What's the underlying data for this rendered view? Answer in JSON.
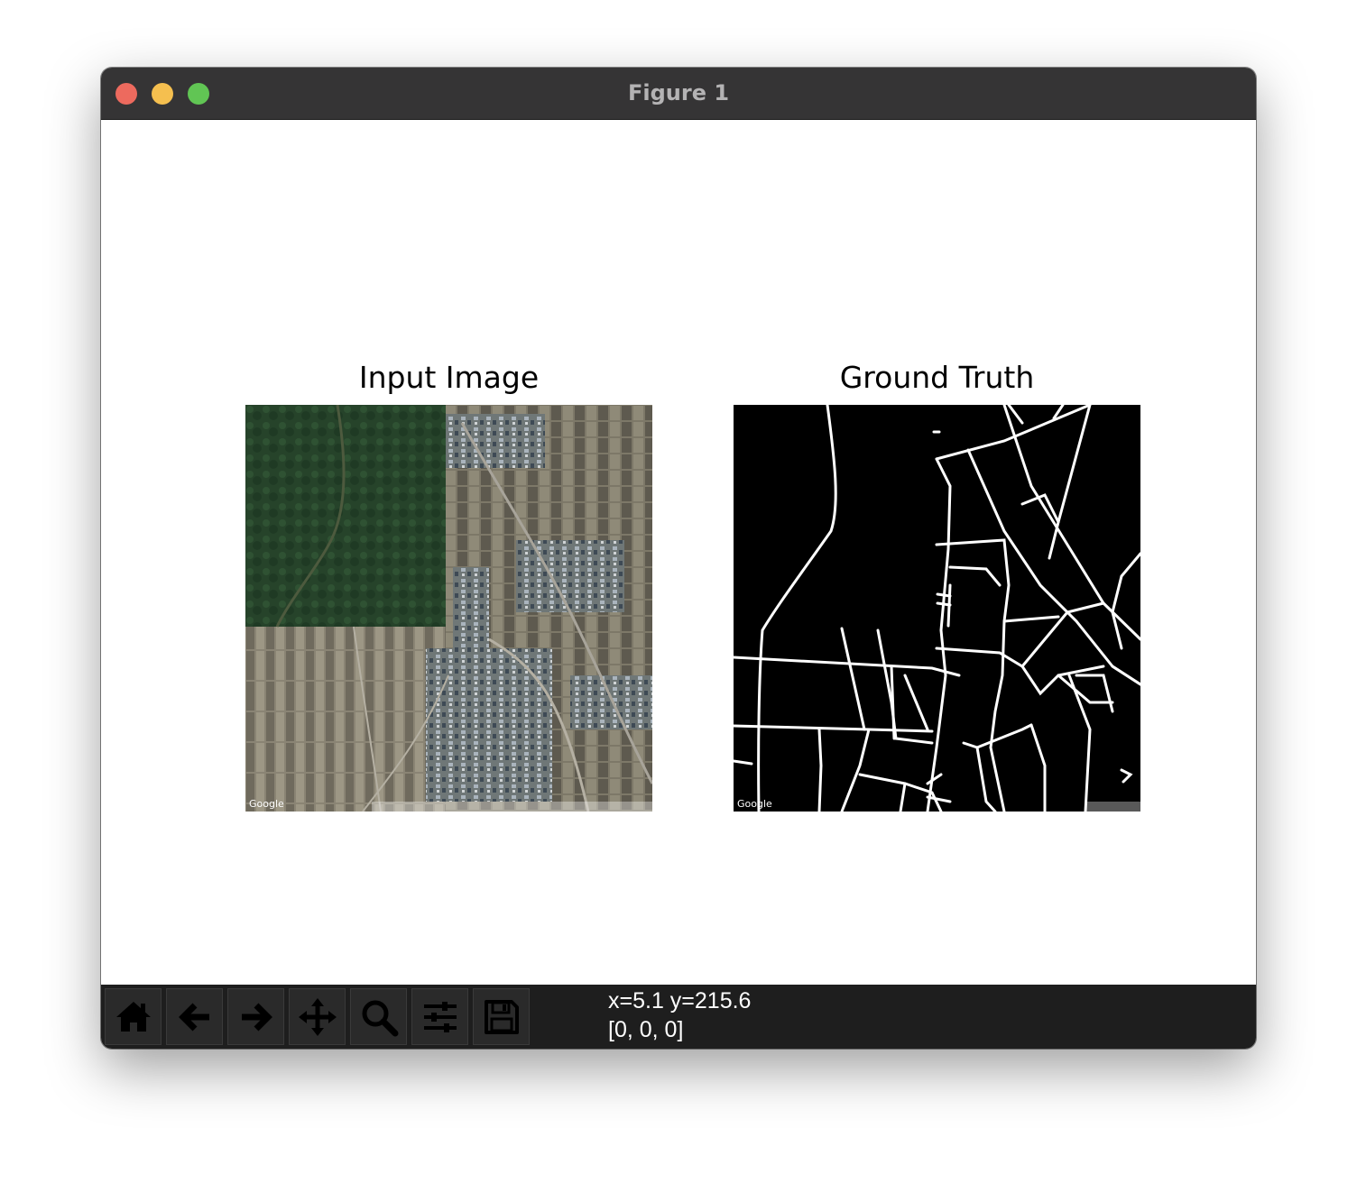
{
  "window": {
    "title": "Figure 1"
  },
  "figure": {
    "panels": [
      {
        "title": "Input Image",
        "watermark": "Google"
      },
      {
        "title": "Ground Truth",
        "watermark": "Google"
      }
    ]
  },
  "toolbar": {
    "tools": [
      {
        "name": "home",
        "icon": "home-icon"
      },
      {
        "name": "back",
        "icon": "arrow-left-icon"
      },
      {
        "name": "forward",
        "icon": "arrow-right-icon"
      },
      {
        "name": "pan",
        "icon": "move-icon"
      },
      {
        "name": "zoom",
        "icon": "magnifier-icon"
      },
      {
        "name": "configure-subplots",
        "icon": "sliders-icon"
      },
      {
        "name": "save",
        "icon": "floppy-disk-icon"
      }
    ],
    "coords_line1": "x=5.1 y=215.6",
    "coords_line2": "[0, 0, 0]"
  },
  "colors": {
    "titlebar": "#353435",
    "toolbar": "#1e1e1e",
    "close": "#ed6a5e",
    "minimize": "#f5bf4f",
    "maximize": "#61c554"
  }
}
